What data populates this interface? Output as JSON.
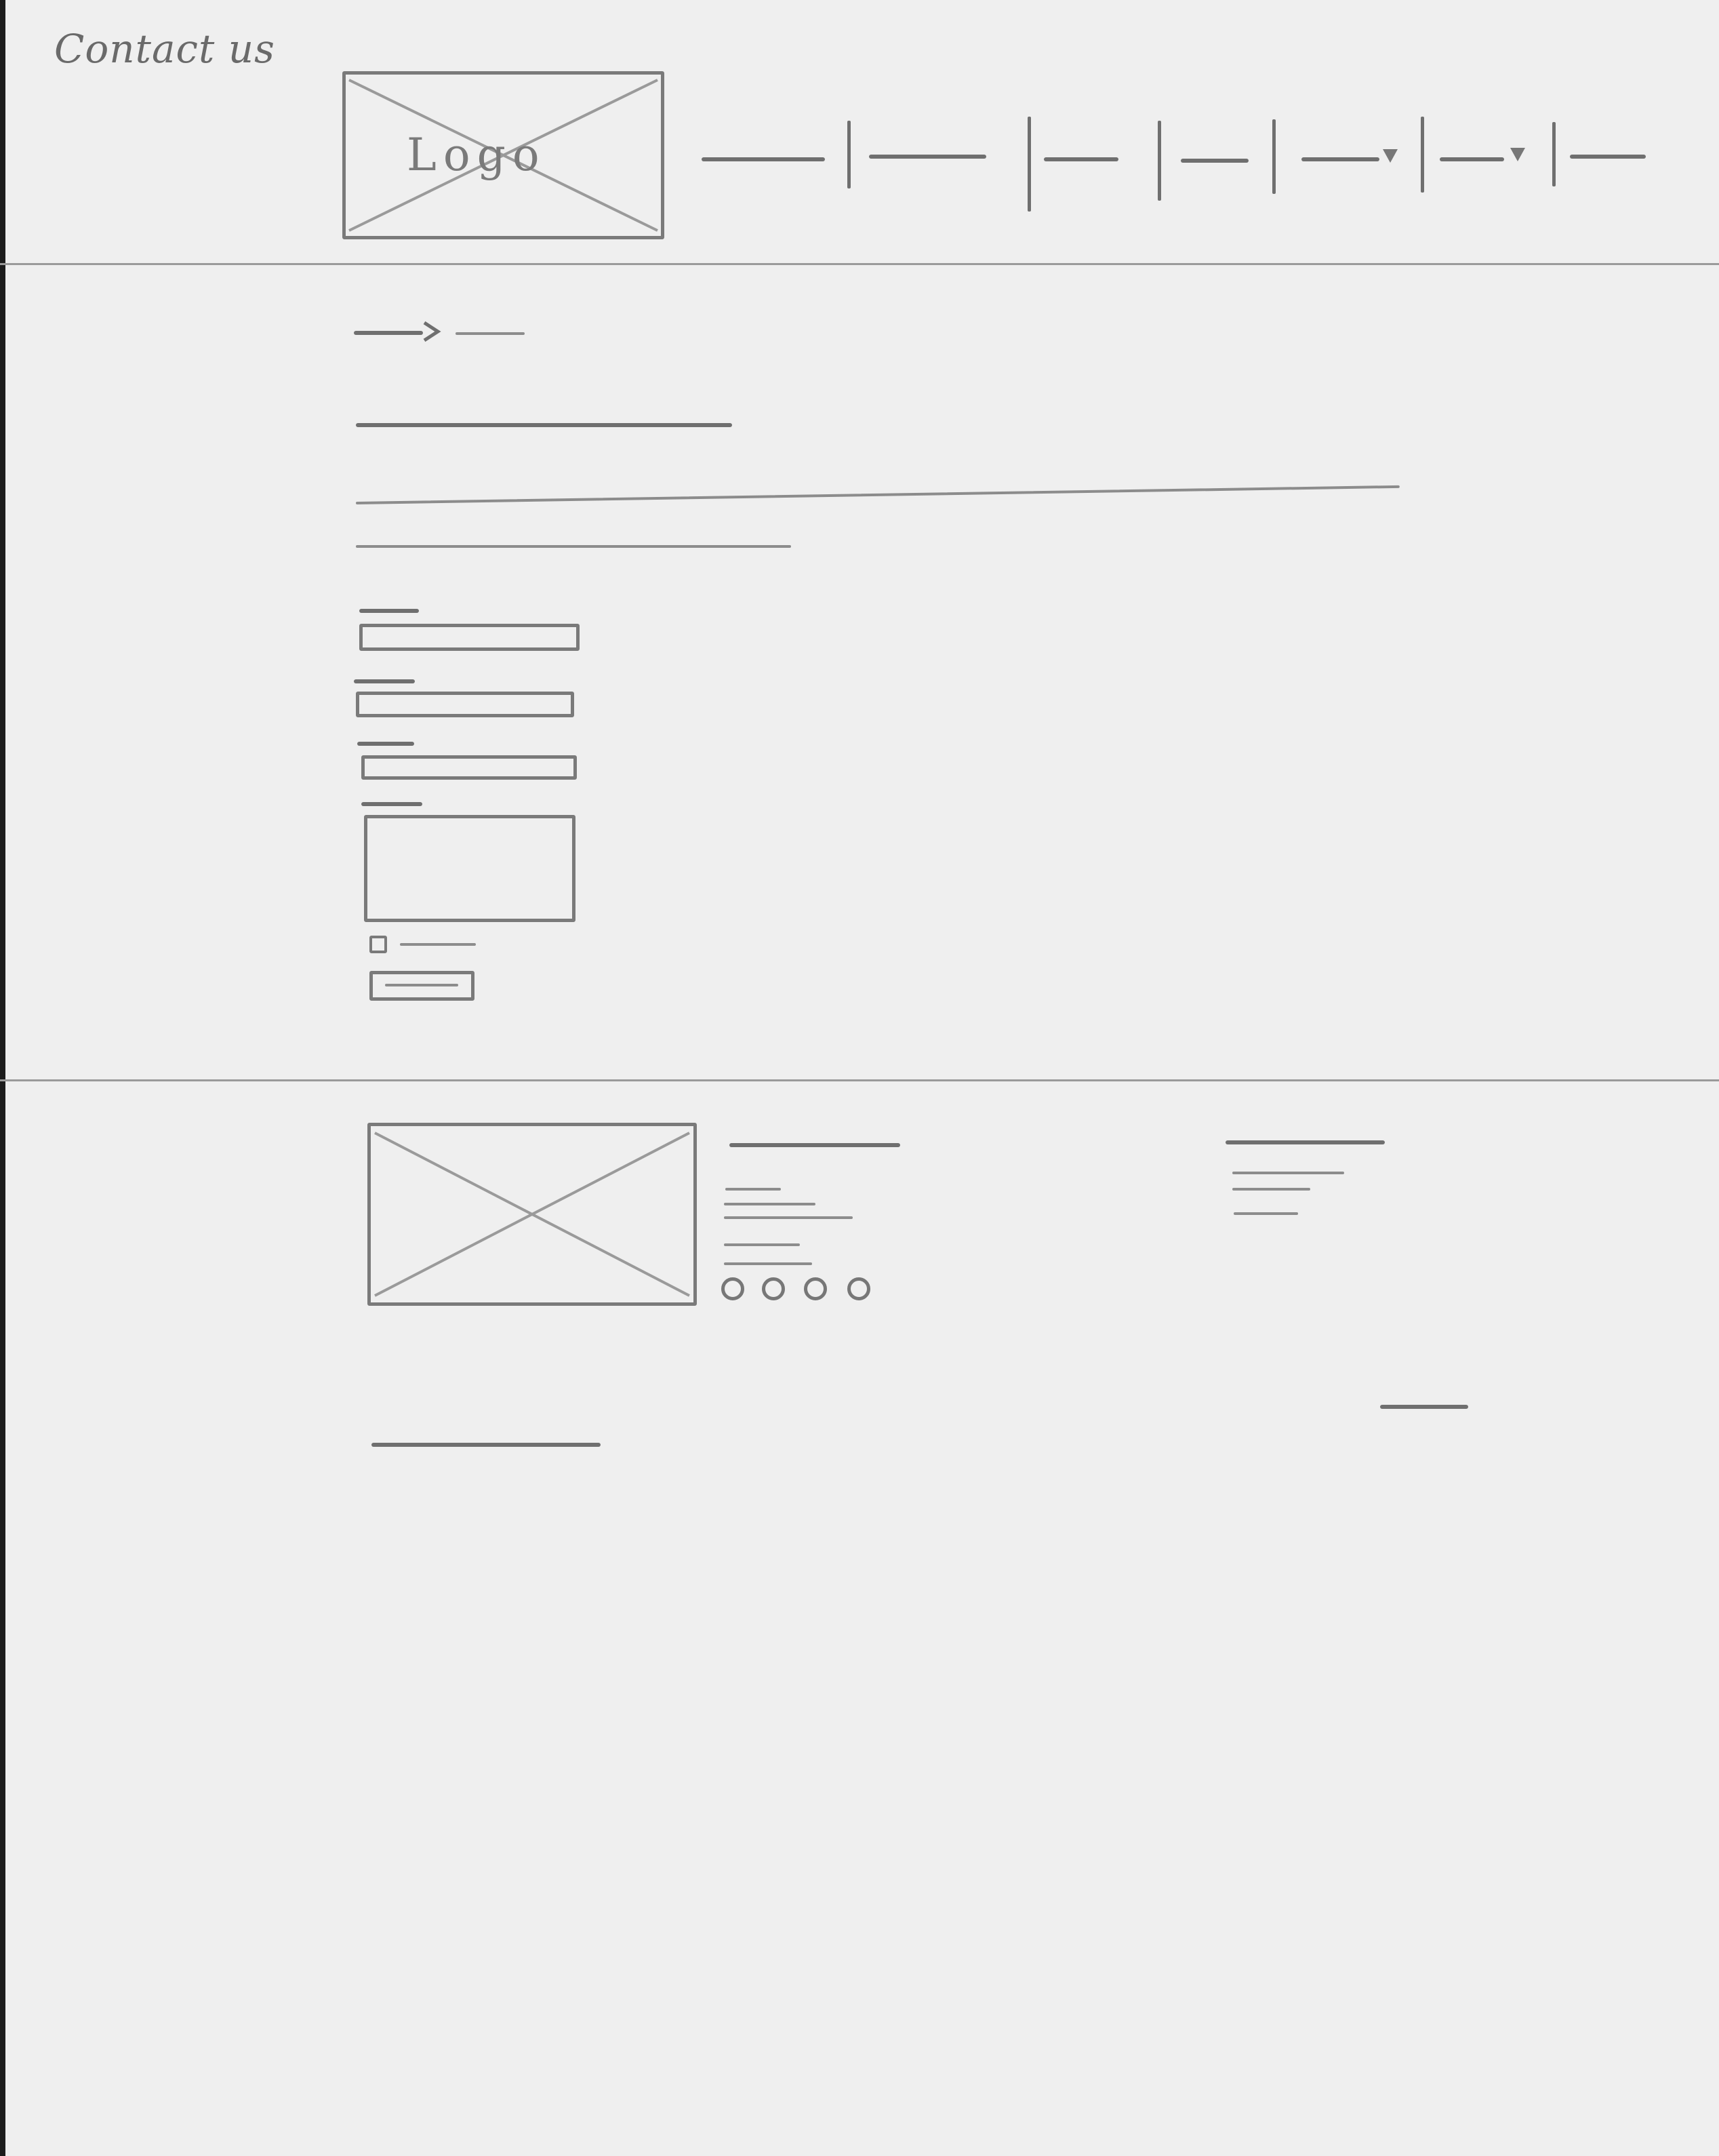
{
  "sketch_title": "Contact us",
  "header": {
    "logo_label": "Logo",
    "nav_items": [
      {
        "label": "",
        "has_dropdown": false
      },
      {
        "label": "",
        "has_dropdown": false
      },
      {
        "label": "",
        "has_dropdown": false
      },
      {
        "label": "",
        "has_dropdown": false
      },
      {
        "label": "",
        "has_dropdown": true
      },
      {
        "label": "",
        "has_dropdown": true
      },
      {
        "label": "",
        "has_dropdown": false
      }
    ]
  },
  "main": {
    "breadcrumb": [
      "",
      ""
    ],
    "page_title": "",
    "intro_text": [
      "",
      ""
    ],
    "form": {
      "fields": [
        {
          "label": "",
          "type": "text",
          "value": ""
        },
        {
          "label": "",
          "type": "text",
          "value": ""
        },
        {
          "label": "",
          "type": "text",
          "value": ""
        },
        {
          "label": "",
          "type": "textarea",
          "value": ""
        }
      ],
      "checkbox_label": "",
      "submit_label": ""
    }
  },
  "footer": {
    "image_placeholder": "",
    "contact": {
      "heading": "",
      "lines": [
        "",
        "",
        "",
        ""
      ],
      "social_icons": [
        "social-icon",
        "social-icon",
        "social-icon",
        "social-icon"
      ]
    },
    "links": {
      "heading": "",
      "items": [
        "",
        "",
        ""
      ]
    },
    "copyright": "",
    "legal_link": ""
  },
  "colors": {
    "paper": "#efefef",
    "pencil": "#7a7a7a"
  }
}
